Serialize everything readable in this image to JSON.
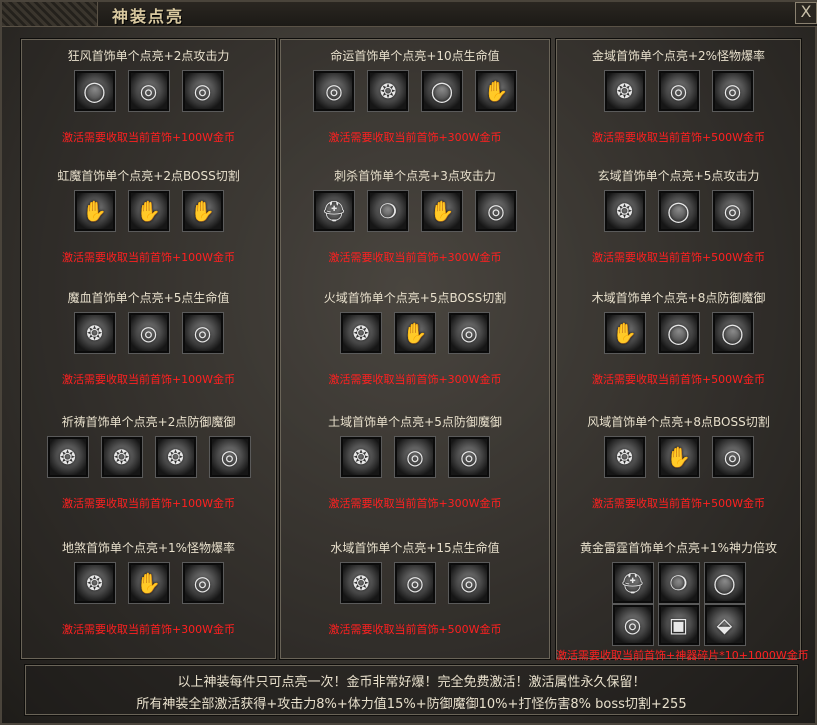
{
  "window": {
    "title": "神装点亮",
    "close_label": "X"
  },
  "columns": [
    {
      "groups": [
        {
          "title": "狂风首饰单个点亮+2点攻击力",
          "requirement": "激活需要收取当前首饰+100W金币",
          "icons": [
            "bracelet-icon",
            "ring-icon",
            "ring-icon"
          ]
        },
        {
          "title": "虹魔首饰单个点亮+2点BOSS切割",
          "requirement": "激活需要收取当前首饰+100W金币",
          "icons": [
            "gauntlet-icon",
            "gauntlet-icon",
            "gauntlet-icon"
          ]
        },
        {
          "title": "魔血首饰单个点亮+5点生命值",
          "requirement": "激活需要收取当前首饰+100W金币",
          "icons": [
            "amulet-icon",
            "ring-icon",
            "ring-icon"
          ]
        },
        {
          "title": "祈祷首饰单个点亮+2点防御魔御",
          "requirement": "激活需要收取当前首饰+100W金币",
          "icons": [
            "amulet-icon",
            "amulet-icon",
            "amulet-icon",
            "ring-icon"
          ]
        },
        {
          "title": "地煞首饰单个点亮+1%怪物爆率",
          "requirement": "激活需要收取当前首饰+300W金币",
          "icons": [
            "amulet-icon",
            "gauntlet-icon",
            "ring-icon"
          ]
        }
      ]
    },
    {
      "groups": [
        {
          "title": "命运首饰单个点亮+10点生命值",
          "requirement": "激活需要收取当前首饰+300W金币",
          "icons": [
            "ring-icon",
            "amulet-icon",
            "bracelet-icon",
            "gauntlet-icon"
          ]
        },
        {
          "title": "刺杀首饰单个点亮+3点攻击力",
          "requirement": "激活需要收取当前首饰+300W金币",
          "icons": [
            "helmet-icon",
            "necklace-icon",
            "gauntlet-icon",
            "ring-icon"
          ]
        },
        {
          "title": "火域首饰单个点亮+5点BOSS切割",
          "requirement": "激活需要收取当前首饰+300W金币",
          "icons": [
            "amulet-icon",
            "gauntlet-icon",
            "ring-icon"
          ]
        },
        {
          "title": "土域首饰单个点亮+5点防御魔御",
          "requirement": "激活需要收取当前首饰+300W金币",
          "icons": [
            "amulet-icon",
            "ring-icon",
            "ring-icon"
          ]
        },
        {
          "title": "水域首饰单个点亮+15点生命值",
          "requirement": "激活需要收取当前首饰+500W金币",
          "icons": [
            "amulet-icon",
            "ring-icon",
            "ring-icon"
          ]
        }
      ]
    },
    {
      "groups": [
        {
          "title": "金域首饰单个点亮+2%怪物爆率",
          "requirement": "激活需要收取当前首饰+500W金币",
          "icons": [
            "amulet-icon",
            "ring-icon",
            "ring-icon"
          ]
        },
        {
          "title": "玄域首饰单个点亮+5点攻击力",
          "requirement": "激活需要收取当前首饰+500W金币",
          "icons": [
            "amulet-icon",
            "bracelet-icon",
            "ring-icon"
          ]
        },
        {
          "title": "木域首饰单个点亮+8点防御魔御",
          "requirement": "激活需要收取当前首饰+500W金币",
          "icons": [
            "gauntlet-icon",
            "bracelet-icon",
            "bracelet-icon"
          ]
        },
        {
          "title": "风域首饰单个点亮+8点BOSS切割",
          "requirement": "激活需要收取当前首饰+500W金币",
          "icons": [
            "amulet-icon",
            "gauntlet-icon",
            "ring-icon"
          ]
        },
        {
          "title": "黄金雷霆首饰单个点亮+1%神力倍攻",
          "requirement": "激活需要收取当前首饰+神器碎片*10+1000W金币",
          "icons": [
            "helmet-icon",
            "necklace-icon",
            "bracelet-icon",
            "ring-icon",
            "chest-icon",
            "boots-icon"
          ]
        }
      ]
    }
  ],
  "footer": {
    "line1": "以上神装每件只可点亮一次！金币非常好爆！完全免费激活！激活属性永久保留！",
    "line2": "所有神装全部激活获得+攻击力8%+体力值15%+防御魔御10%+打怪伤害8% boss切割+255"
  },
  "colors": {
    "requirement_text": "#ff2020",
    "title_text": "#e8e0cc"
  }
}
